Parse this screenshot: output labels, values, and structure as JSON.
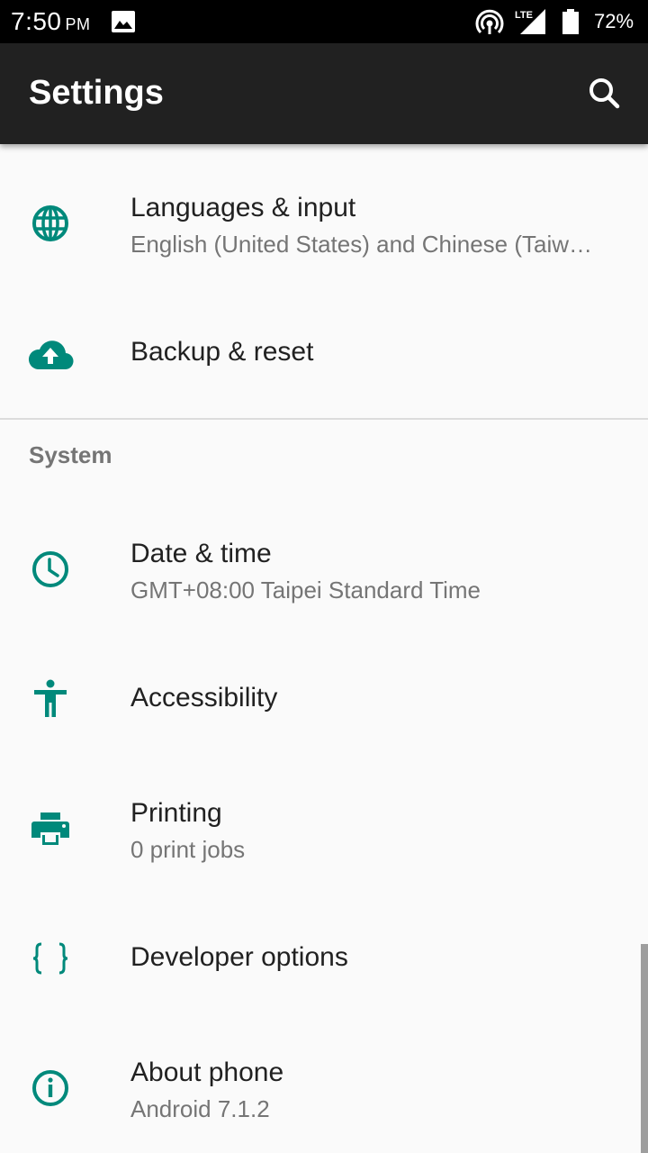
{
  "status_bar": {
    "time": "7:50",
    "ampm": "PM",
    "network": "LTE",
    "battery": "72%",
    "icons": [
      "image-icon",
      "hotspot-icon",
      "lte-signal-icon",
      "battery-icon"
    ]
  },
  "app_bar": {
    "title": "Settings",
    "search_icon": "search-icon"
  },
  "accent_color": "#00897b",
  "list": {
    "languages": {
      "title": "Languages & input",
      "subtitle": "English (United States) and Chinese (Taiw…",
      "icon": "globe-icon"
    },
    "backup": {
      "title": "Backup & reset",
      "icon": "cloud-upload-icon"
    },
    "section_system": "System",
    "date_time": {
      "title": "Date & time",
      "subtitle": "GMT+08:00 Taipei Standard Time",
      "icon": "clock-icon"
    },
    "accessibility": {
      "title": "Accessibility",
      "icon": "accessibility-icon"
    },
    "printing": {
      "title": "Printing",
      "subtitle": "0 print jobs",
      "icon": "printer-icon"
    },
    "developer": {
      "title": "Developer options",
      "icon": "braces-icon"
    },
    "about": {
      "title": "About phone",
      "subtitle": "Android 7.1.2",
      "icon": "info-icon"
    }
  }
}
